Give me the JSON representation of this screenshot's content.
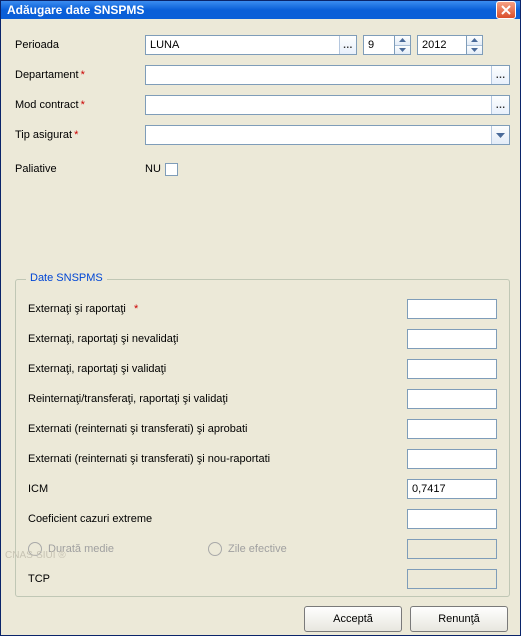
{
  "window": {
    "title": "Adăugare date SNSPMS"
  },
  "form": {
    "perioada_label": "Perioada",
    "perioada_value": "LUNA",
    "month_value": "9",
    "year_value": "2012",
    "departament_label": "Departament",
    "departament_value": "",
    "modcontract_label": "Mod contract",
    "modcontract_value": "",
    "tipasigurat_label": "Tip asigurat",
    "tipasigurat_value": "",
    "paliative_label": "Paliative",
    "paliative_value": "NU",
    "paliative_checked": false
  },
  "group": {
    "legend": "Date SNSPMS",
    "rows": {
      "r0": {
        "label": "Externaţi şi raportaţi",
        "required": true,
        "value": ""
      },
      "r1": {
        "label": "Externaţi, raportaţi şi nevalidaţi",
        "required": false,
        "value": ""
      },
      "r2": {
        "label": "Externaţi, raportaţi şi validaţi",
        "required": false,
        "value": ""
      },
      "r3": {
        "label": "Reinternaţi/transferaţi, raportaţi şi validaţi",
        "required": false,
        "value": ""
      },
      "r4": {
        "label": "Externati (reinternati şi transferati) şi aprobati",
        "required": false,
        "value": ""
      },
      "r5": {
        "label": "Externati (reinternati şi transferati) şi nou-raportati",
        "required": false,
        "value": ""
      },
      "icm": {
        "label": "ICM",
        "value": "0,7417"
      },
      "coef": {
        "label": "Coeficient cazuri extreme",
        "value": ""
      },
      "durata_label": "Durată medie",
      "zile_label": "Zile efective",
      "tcp": {
        "label": "TCP",
        "value": ""
      }
    }
  },
  "buttons": {
    "accept": "Acceptă",
    "renunta": "Renunţă"
  },
  "watermark": "CNAS-SIUI ®"
}
